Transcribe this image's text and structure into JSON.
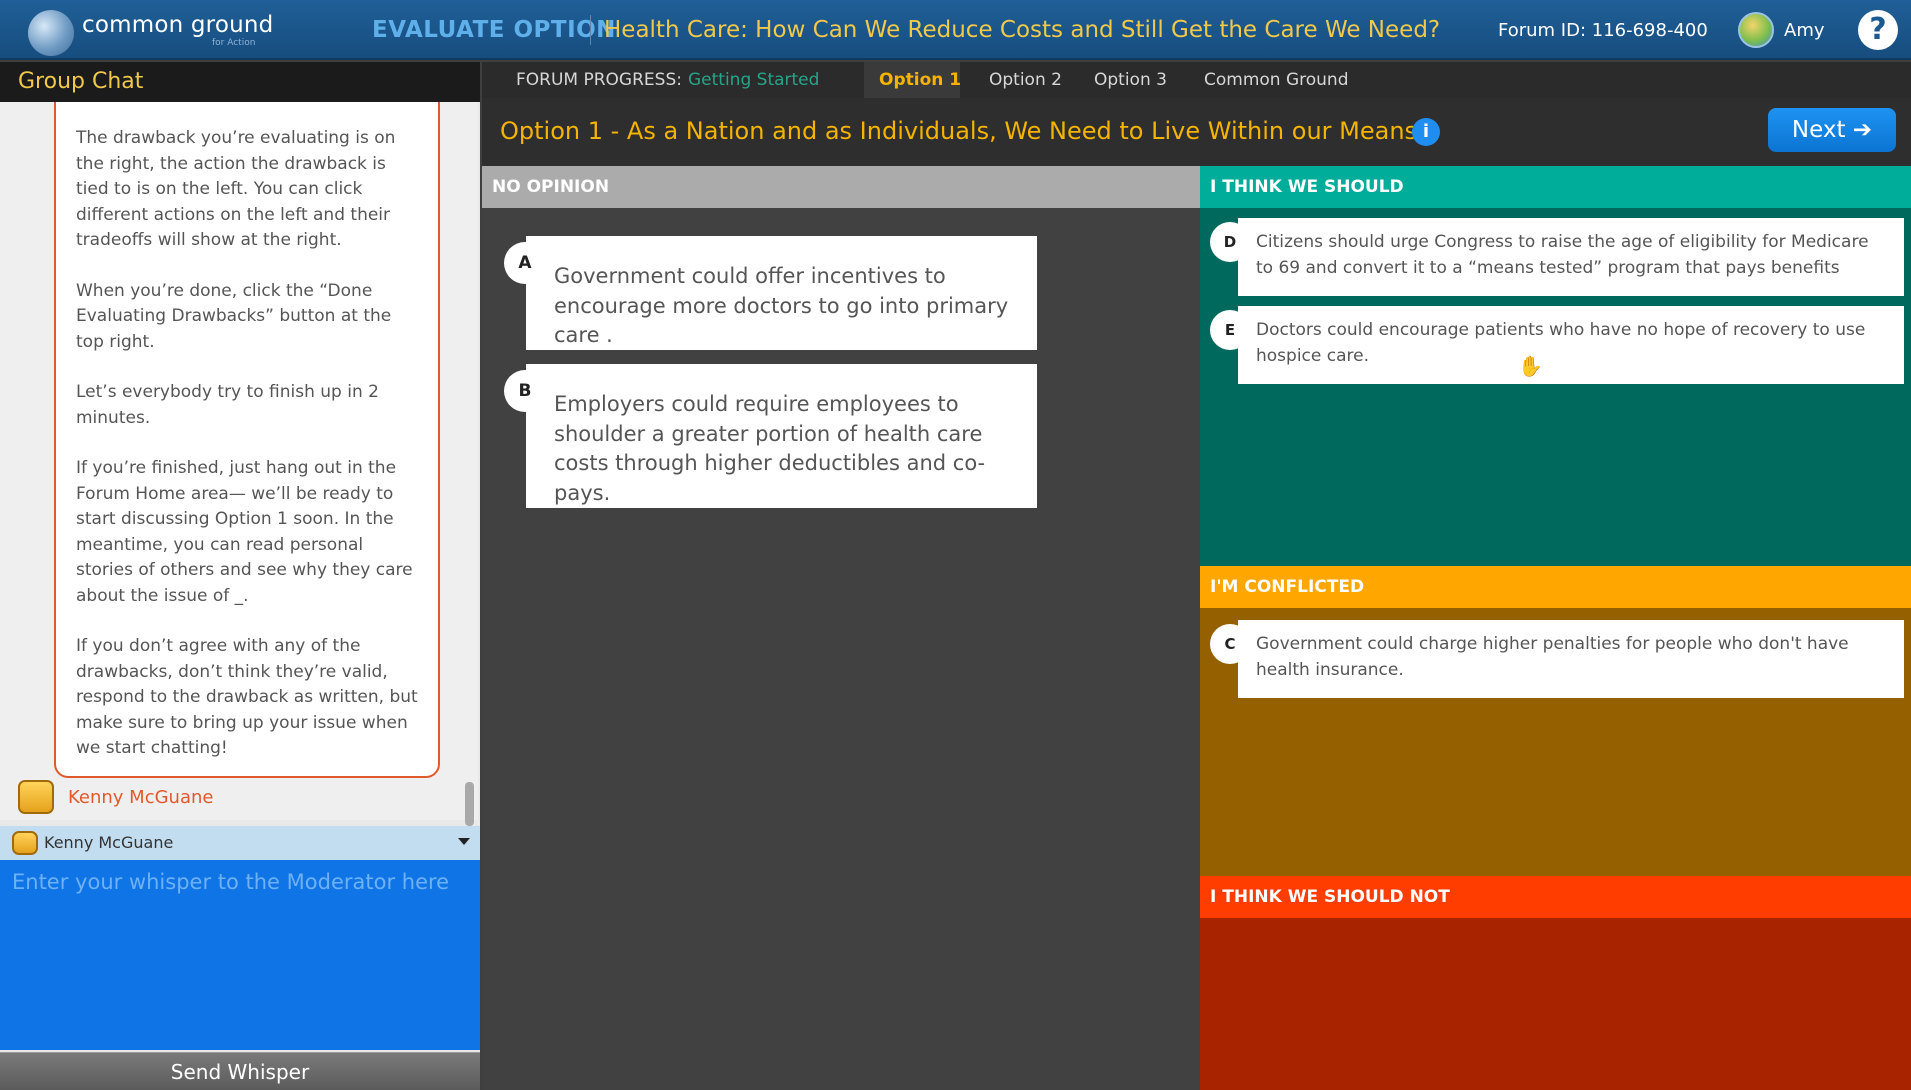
{
  "header": {
    "logo_text": "common ground",
    "logo_subtext": "for Action",
    "section": "EVALUATE OPTION",
    "forum_title": "Health Care: How Can We Reduce Costs and Still Get the Care We Need?",
    "forum_id": "Forum ID: 116-698-400",
    "user_name": "Amy",
    "help_label": "?"
  },
  "chat": {
    "title": "Group Chat",
    "messages": [
      "The drawback you’re evaluating is on the right, the action the drawback is tied to is on the left. You can click different actions on the left and their tradeoffs will show at the right.",
      "When you’re done, click the “Done Evaluating Drawbacks” button at the top right.",
      "Let’s everybody try to finish up in 2 minutes.",
      "If you’re finished, just hang out in the Forum Home area— we’ll be ready to start discussing Option 1 soon. In the meantime, you can read personal stories of others and see why they care about the issue of _.",
      "If you don’t agree with any of the drawbacks, don’t think they’re valid, respond to the drawback as written, but make sure to bring up your issue when we start chatting!"
    ],
    "sender": "Kenny McGuane",
    "recipient": "Kenny McGuane",
    "whisper_placeholder": "Enter your whisper to the Moderator here",
    "send_label": "Send Whisper"
  },
  "progress": {
    "label": "FORUM PROGRESS:",
    "steps": [
      "Getting Started",
      "Option 1",
      "Option 2",
      "Option 3",
      "Common Ground"
    ],
    "current_index": 1
  },
  "option": {
    "title": "Option 1 - As a Nation and as Individuals, We Need to Live Within our Means",
    "info_label": "i",
    "next_label": "Next ➔"
  },
  "columns": {
    "no_opinion": {
      "title": "NO OPINION",
      "cards": [
        {
          "letter": "A",
          "text": "Government could offer incentives to encourage more doctors to go into primary care ."
        },
        {
          "letter": "B",
          "text": "Employers could require employees to shoulder a greater portion of health care costs through higher deductibles and co-pays."
        }
      ]
    },
    "should": {
      "title": "I THINK WE SHOULD",
      "cards": [
        {
          "letter": "D",
          "text": "Citizens should urge Congress to raise the age of eligibility for Medicare to 69 and convert it to a “means tested” program that pays benefits"
        },
        {
          "letter": "E",
          "text": "Doctors could encourage patients who have no hope of recovery to use hospice care."
        }
      ]
    },
    "conflicted": {
      "title": "I'M CONFLICTED",
      "cards": [
        {
          "letter": "C",
          "text": "Government could charge higher penalties for people who don't have health insurance."
        }
      ]
    },
    "should_not": {
      "title": "I THINK WE SHOULD NOT",
      "cards": []
    }
  },
  "colors": {
    "should": "#00ad9a",
    "conflicted": "#ffa600",
    "should_not": "#ff3d00",
    "accent": "#f4b400",
    "whisper_bg": "#0f74e6"
  }
}
